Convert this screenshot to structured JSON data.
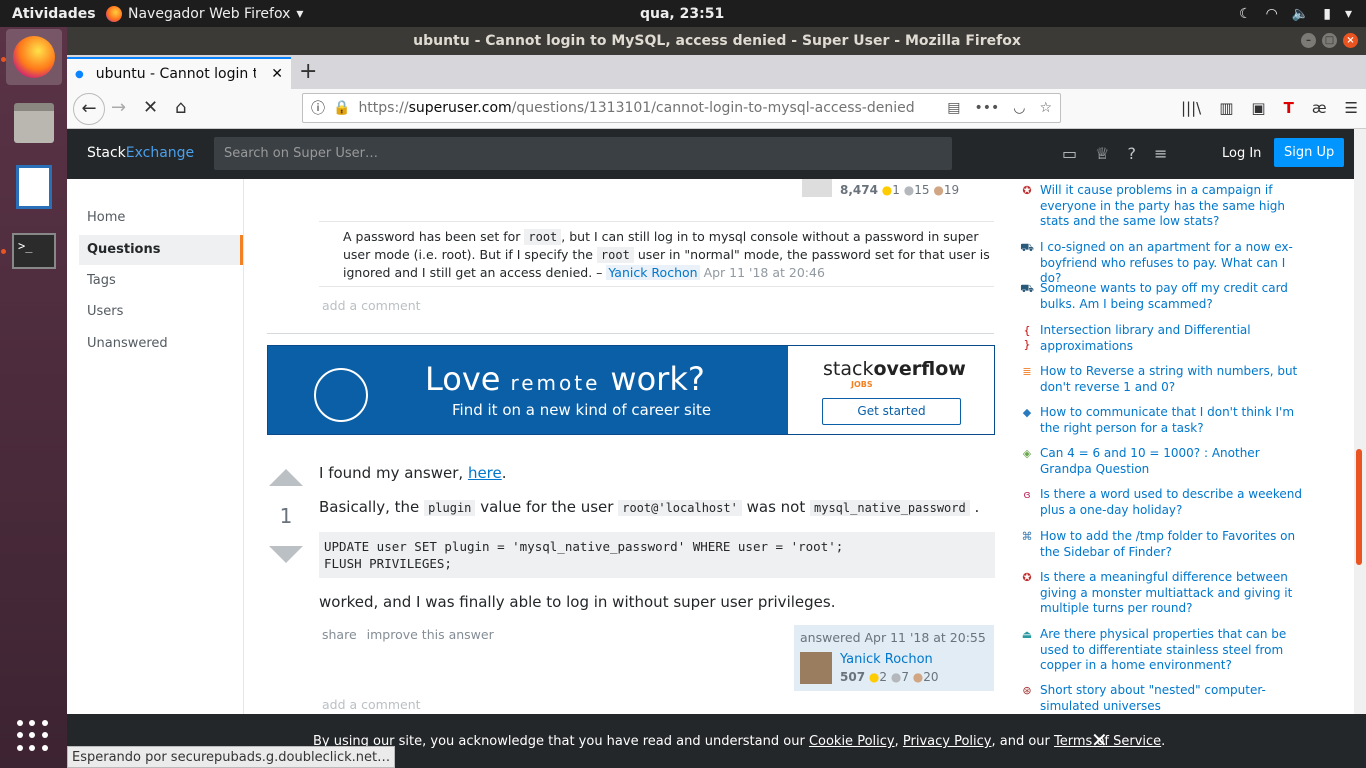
{
  "topbar": {
    "activities": "Atividades",
    "app_name": "Navegador Web Firefox",
    "clock": "qua, 23:51"
  },
  "window": {
    "title": "ubuntu - Cannot login to MySQL, access denied - Super User - Mozilla Firefox"
  },
  "tab": {
    "title": "ubuntu - Cannot login to MySQL, access denied"
  },
  "url": {
    "scheme": "https://",
    "host": "superuser.com",
    "path": "/questions/1313101/cannot-login-to-mysql-access-denied"
  },
  "se_header": {
    "logo_a": "Stack",
    "logo_b": "Exchange",
    "search_placeholder": "Search on Super User…",
    "login": "Log In",
    "signup": "Sign Up"
  },
  "leftnav": [
    "Home",
    "Questions",
    "Tags",
    "Users",
    "Unanswered"
  ],
  "asker": {
    "rep": "8,474",
    "gold": "1",
    "silver": "15",
    "bronze": "19"
  },
  "comment1": {
    "t1": "A password has been set for",
    "c1": "root",
    "t2": ", but I can still log in to mysql console without a password in super user mode (i.e. root). But if I specify the",
    "c2": "root",
    "t3": "user in \"normal\" mode, the password set for that user is ignored and I still get an access denied. –",
    "author": "Yanick Rochon",
    "date": "Apr 11 '18 at 20:46"
  },
  "add_comment": "add a comment",
  "ad": {
    "love": "Love",
    "remote": "remote",
    "work": "work?",
    "sub": "Find it on a new kind of career site",
    "so_a": "stack",
    "so_b": "overflow",
    "jobs": "JOBS",
    "cta": "Get started"
  },
  "answer": {
    "votes": "1",
    "p1a": "I found my answer,",
    "p1link": "here",
    "p1b": ".",
    "p2a": "Basically, the",
    "p2c1": "plugin",
    "p2b": "value for the user",
    "p2c2": "root@'localhost'",
    "p2c": "was not",
    "p2c3": "mysql_native_password",
    "p2d": ".",
    "code_l1": "UPDATE user SET plugin = 'mysql_native_password' WHERE user = 'root';",
    "code_l2": "FLUSH PRIVILEGES;",
    "p3": "worked, and I was finally able to log in without super user privileges.",
    "share": "share",
    "improve": "improve this answer",
    "answered": "answered Apr 11 '18 at 20:55",
    "author": "Yanick Rochon",
    "rep": "507",
    "gold": "2",
    "silver": "7",
    "bronze": "20"
  },
  "hot": [
    "Will it cause problems in a campaign if everyone in the party has the same high stats and the same low stats?",
    "I co-signed on an apartment for a now ex-boyfriend who refuses to pay. What can I do?",
    "Someone wants to pay off my credit card bulks. Am I being scammed?",
    "Intersection library and Differential approximations",
    "How to Reverse a string with numbers, but don't reverse 1 and 0?",
    "How to communicate that I don't think I'm the right person for a task?",
    "Can 4 = 6 and 10 = 1000? : Another Grandpa Question",
    "Is there a word used to describe a weekend plus a one-day holiday?",
    "How to add the /tmp folder to Favorites on the Sidebar of Finder?",
    "Is there a meaningful difference between giving a monster multiattack and giving it multiple turns per round?",
    "Are there physical properties that can be used to differentiate stainless steel from copper in a home environment?",
    "Short story about \"nested\" computer-simulated universes"
  ],
  "cookie": {
    "a": "By using our site, you acknowledge that you have read and understand our",
    "l1": "Cookie Policy",
    "b": ",",
    "l2": "Privacy Policy",
    "c": ", and our",
    "l3": "Terms of Service",
    "d": "."
  },
  "status": "Esperando por securepubads.g.doubleclick.net…",
  "colors": {
    "accent": "#e95420",
    "se_blue": "#0095ff",
    "link": "#0077cc",
    "ad_blue": "#0a5fa7"
  }
}
